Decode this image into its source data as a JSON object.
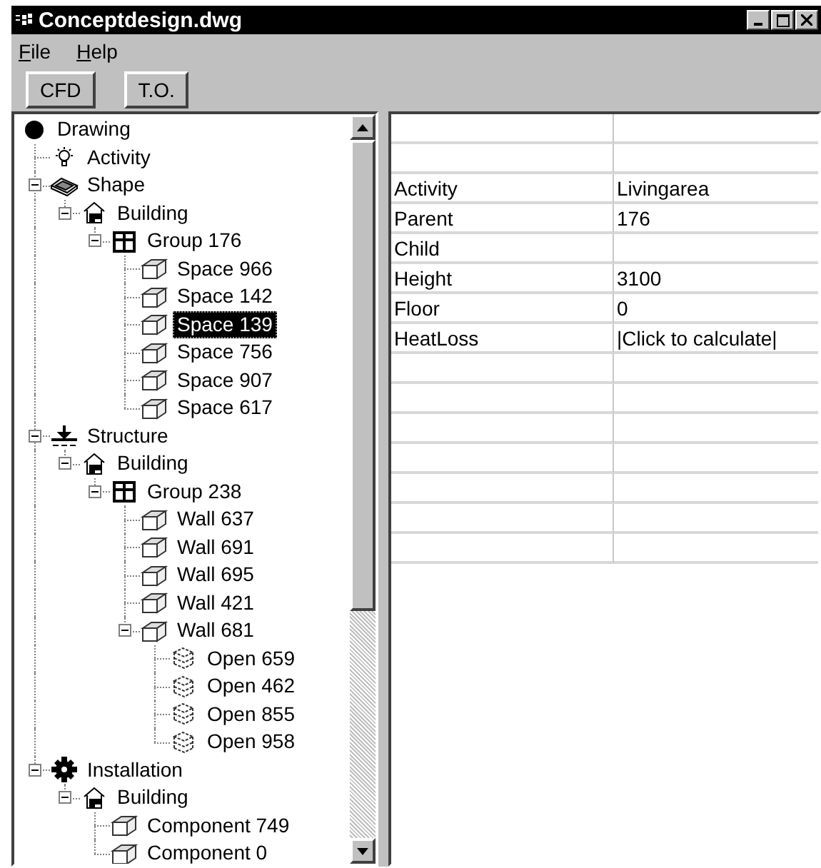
{
  "window": {
    "title": "Conceptdesign.dwg"
  },
  "menu": [
    {
      "label": "File"
    },
    {
      "label": "Help"
    }
  ],
  "toolbar": [
    {
      "label": "CFD"
    },
    {
      "label": "T.O."
    }
  ],
  "tree": [
    {
      "label": "Drawing",
      "kind": "root",
      "selected": false,
      "children": [
        {
          "label": "Activity",
          "kind": "activity",
          "selected": false
        },
        {
          "label": "Shape",
          "kind": "shape",
          "selected": false,
          "expanded": true,
          "children": [
            {
              "label": "Building",
              "kind": "building",
              "selected": false,
              "expanded": true,
              "children": [
                {
                  "label": "Group 176",
                  "kind": "group",
                  "selected": false,
                  "expanded": true,
                  "children": [
                    {
                      "label": "Space 966",
                      "kind": "element",
                      "selected": false
                    },
                    {
                      "label": "Space 142",
                      "kind": "element",
                      "selected": false
                    },
                    {
                      "label": "Space 139",
                      "kind": "element",
                      "selected": true
                    },
                    {
                      "label": "Space 756",
                      "kind": "element",
                      "selected": false
                    },
                    {
                      "label": "Space 907",
                      "kind": "element",
                      "selected": false
                    },
                    {
                      "label": "Space 617",
                      "kind": "element",
                      "selected": false
                    }
                  ]
                }
              ]
            }
          ]
        },
        {
          "label": "Structure",
          "kind": "structure",
          "selected": false,
          "expanded": true,
          "children": [
            {
              "label": "Building",
              "kind": "building",
              "selected": false,
              "expanded": true,
              "children": [
                {
                  "label": "Group 238",
                  "kind": "group",
                  "selected": false,
                  "expanded": true,
                  "children": [
                    {
                      "label": "Wall 637",
                      "kind": "element",
                      "selected": false
                    },
                    {
                      "label": "Wall 691",
                      "kind": "element",
                      "selected": false
                    },
                    {
                      "label": "Wall 695",
                      "kind": "element",
                      "selected": false
                    },
                    {
                      "label": "Wall 421",
                      "kind": "element",
                      "selected": false
                    },
                    {
                      "label": "Wall 681",
                      "kind": "element",
                      "selected": false,
                      "expanded": true,
                      "children": [
                        {
                          "label": "Open 659",
                          "kind": "opening",
                          "selected": false
                        },
                        {
                          "label": "Open 462",
                          "kind": "opening",
                          "selected": false
                        },
                        {
                          "label": "Open 855",
                          "kind": "opening",
                          "selected": false
                        },
                        {
                          "label": "Open 958",
                          "kind": "opening",
                          "selected": false
                        }
                      ]
                    }
                  ]
                }
              ]
            }
          ]
        },
        {
          "label": "Installation",
          "kind": "installation",
          "selected": false,
          "expanded": true,
          "children": [
            {
              "label": "Building",
              "kind": "building",
              "selected": false,
              "expanded": true,
              "children": [
                {
                  "label": "Component 749",
                  "kind": "element",
                  "selected": false
                },
                {
                  "label": "Component 0",
                  "kind": "element",
                  "selected": false
                }
              ]
            }
          ]
        }
      ]
    }
  ],
  "properties": [
    {
      "kind": "blank"
    },
    {
      "kind": "blank"
    },
    {
      "kind": "property",
      "name": "Activity",
      "value": "Livingarea"
    },
    {
      "kind": "property",
      "name": "Parent",
      "value": "176"
    },
    {
      "kind": "property",
      "name": "Child"
    },
    {
      "kind": "property",
      "name": "Height",
      "value": "3100"
    },
    {
      "kind": "property",
      "name": "Floor",
      "value": "0"
    },
    {
      "kind": "property",
      "name": "HeatLoss",
      "value": "|Click to calculate|"
    },
    {
      "kind": "blank"
    },
    {
      "kind": "blank"
    },
    {
      "kind": "blank"
    },
    {
      "kind": "blank"
    },
    {
      "kind": "blank"
    },
    {
      "kind": "blank"
    },
    {
      "kind": "blank"
    }
  ]
}
